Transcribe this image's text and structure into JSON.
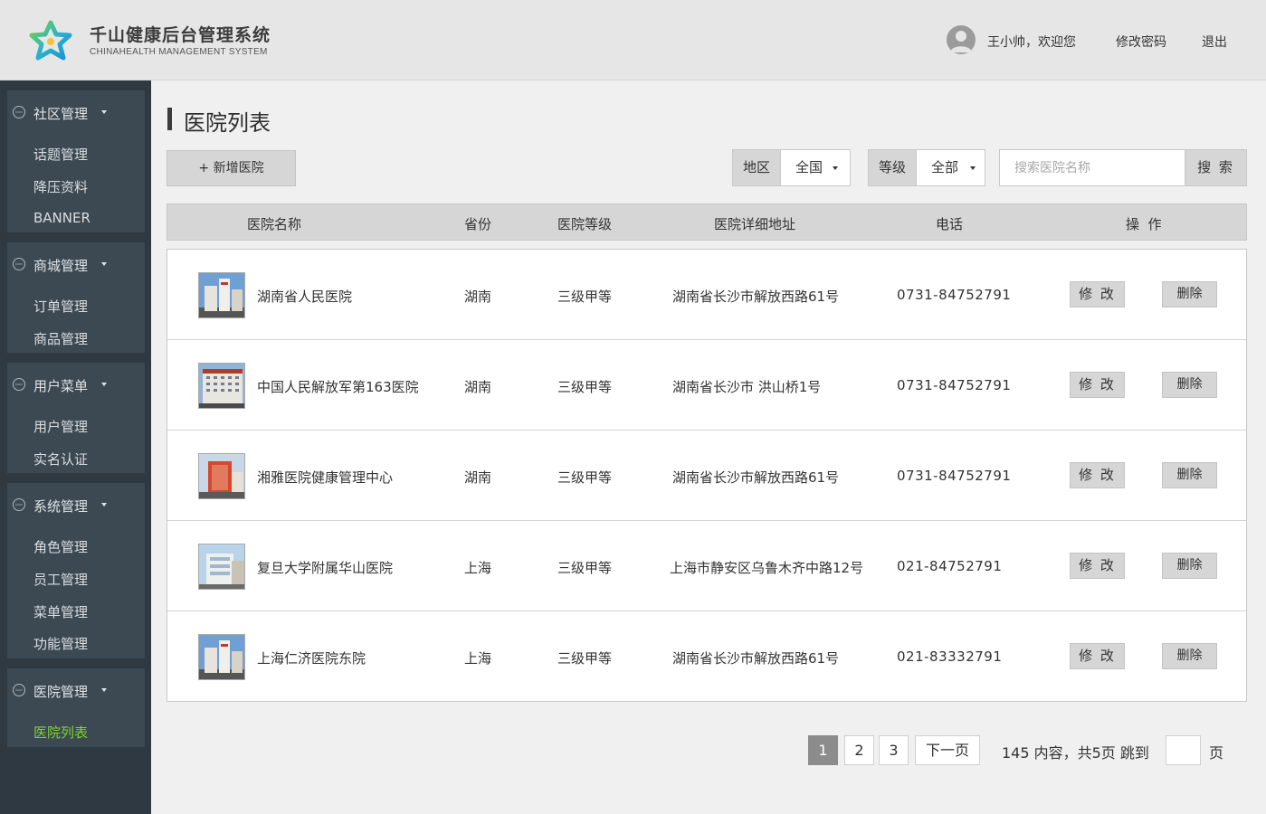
{
  "header": {
    "title": "千山健康后台管理系统",
    "subtitle": "CHINAHEALTH  MANAGEMENT SYSTEM",
    "welcome": "王小帅，欢迎您",
    "change_password": "修改密码",
    "logout": "退出"
  },
  "sidebar": {
    "icon_text": "icon",
    "groups": [
      {
        "label": "社区管理",
        "items": [
          "话题管理",
          "降压资料",
          "BANNER"
        ]
      },
      {
        "label": "商城管理",
        "items": [
          "订单管理",
          "商品管理"
        ]
      },
      {
        "label": "用户菜单",
        "items": [
          "用户管理",
          "实名认证"
        ]
      },
      {
        "label": "系统管理",
        "items": [
          "角色管理",
          "员工管理",
          "菜单管理",
          "功能管理"
        ]
      },
      {
        "label": "医院管理",
        "items": [
          "医院列表"
        ]
      }
    ],
    "active_item": "医院列表"
  },
  "page": {
    "title": "医院列表",
    "add_button": "+ 新增医院"
  },
  "filters": {
    "region_label": "地区",
    "region_value": "全国",
    "level_label": "等级",
    "level_value": "全部",
    "search_placeholder": "搜索医院名称",
    "search_button": "搜 索"
  },
  "table": {
    "headers": [
      "医院名称",
      "省份",
      "医院等级",
      "医院详细地址",
      "电话",
      "操  作"
    ],
    "edit_label": "修 改",
    "delete_label": "删除",
    "rows": [
      {
        "name": "湖南省人民医院",
        "province": "湖南",
        "level": "三级甲等",
        "address": "湖南省长沙市解放西路61号",
        "phone": "0731-84752791"
      },
      {
        "name": "中国人民解放军第163医院",
        "province": "湖南",
        "level": "三级甲等",
        "address": "湖南省长沙市 洪山桥1号",
        "phone": "0731-84752791"
      },
      {
        "name": "湘雅医院健康管理中心",
        "province": "湖南",
        "level": "三级甲等",
        "address": "湖南省长沙市解放西路61号",
        "phone": "0731-84752791"
      },
      {
        "name": "复旦大学附属华山医院",
        "province": "上海",
        "level": "三级甲等",
        "address": "上海市静安区乌鲁木齐中路12号",
        "phone": "021-84752791"
      },
      {
        "name": "上海仁济医院东院",
        "province": "上海",
        "level": "三级甲等",
        "address": "湖南省长沙市解放西路61号",
        "phone": "021-83332791"
      }
    ]
  },
  "pagination": {
    "pages": [
      "1",
      "2",
      "3"
    ],
    "current_page": "1",
    "next": "下一页",
    "info": "145 内容，共5页  跳到",
    "suffix": "页"
  },
  "colors": {
    "sidebar_bg": "#2e3942",
    "sidebar_group_bg": "#3d4952",
    "active_green": "#7ed13a",
    "button_gray": "#d6d6d6"
  }
}
